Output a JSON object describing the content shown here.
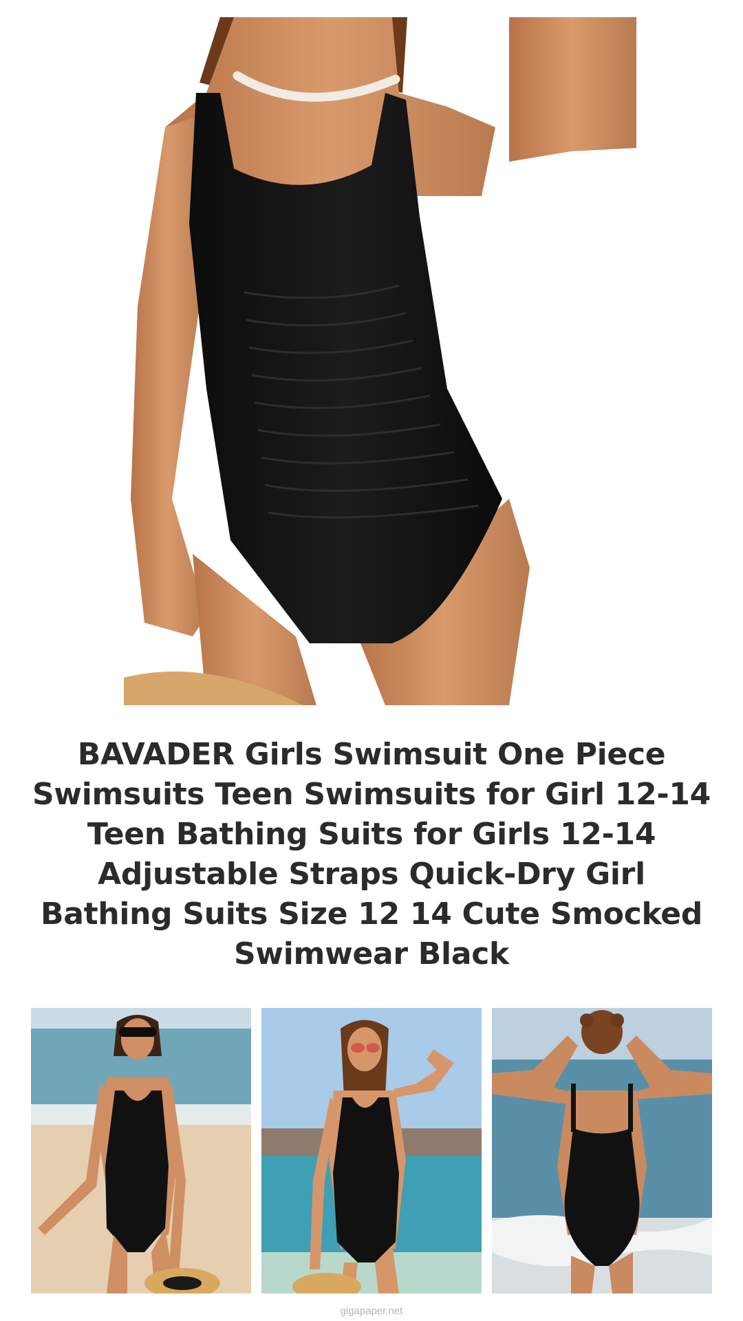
{
  "product": {
    "title": "BAVADER Girls Swimsuit One Piece Swimsuits Teen Swimsuits for Girl 12-14 Teen Bathing Suits for Girls 12-14 Adjustable Straps Quick-Dry Girl Bathing Suits Size 12 14 Cute Smocked Swimwear Black",
    "main_image": {
      "icon": "product-photo-front",
      "swimsuit_color": "#111111",
      "skin_color": "#c98a60"
    },
    "gallery": [
      {
        "icon": "product-photo-beach-front-sunglasses"
      },
      {
        "icon": "product-photo-beach-front-pose"
      },
      {
        "icon": "product-photo-beach-back"
      }
    ]
  },
  "footer": {
    "watermark": "gigapaper.net"
  },
  "colors": {
    "background": "#ffffff",
    "title_text": "#2b2b2b",
    "watermark_text": "#b5b5b5"
  }
}
